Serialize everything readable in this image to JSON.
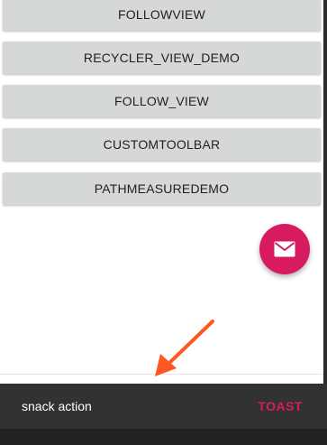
{
  "buttons": [
    {
      "label": "FOLLOWVIEW"
    },
    {
      "label": "RECYCLER_VIEW_DEMO"
    },
    {
      "label": "FOLLOW_VIEW"
    },
    {
      "label": "CUSTOMTOOLBAR"
    },
    {
      "label": "PATHMEASUREDEMO"
    }
  ],
  "fab": {
    "icon": "mail-icon",
    "color": "#d81b60"
  },
  "snackbar": {
    "message": "snack action",
    "action_label": "TOAST",
    "action_color": "#d81b60",
    "background": "#323232"
  },
  "annotation": {
    "icon": "arrow-icon",
    "color": "#ff5722"
  }
}
